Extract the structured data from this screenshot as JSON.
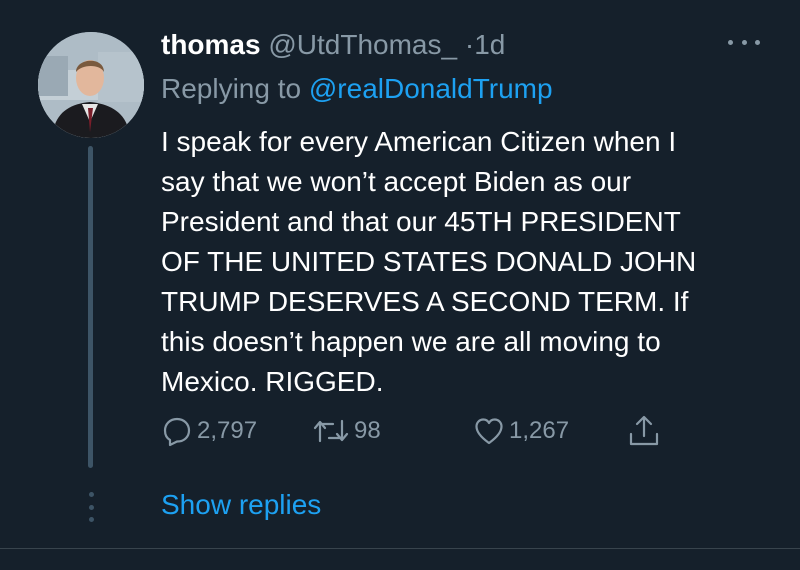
{
  "tweet": {
    "display_name": "thomas",
    "handle": "@UtdThomas_",
    "separator": "·",
    "time": "1d",
    "replying_prefix": "Replying to ",
    "replying_to": "@realDonaldTrump",
    "text_lines": [
      "I speak for every American Citizen when I",
      "say that we won’t accept Biden as our",
      "President and that our 45TH PRESIDENT",
      "OF THE UNITED STATES DONALD JOHN",
      "TRUMP DESERVES A SECOND TERM. If",
      "this doesn’t happen we are all moving to",
      "Mexico. RIGGED."
    ],
    "reply_count": "2,797",
    "retweet_count": "98",
    "like_count": "1,267",
    "show_replies_label": "Show replies"
  },
  "icons": {
    "more": "more-horizontal-icon",
    "reply": "reply-bubble-icon",
    "retweet": "retweet-icon",
    "like": "heart-icon",
    "share": "share-icon"
  },
  "colors": {
    "background": "#15202b",
    "text_primary": "#ffffff",
    "text_secondary": "#8899a6",
    "accent": "#1da1f2",
    "thread_line": "#3d5466",
    "divider": "#38444d"
  }
}
